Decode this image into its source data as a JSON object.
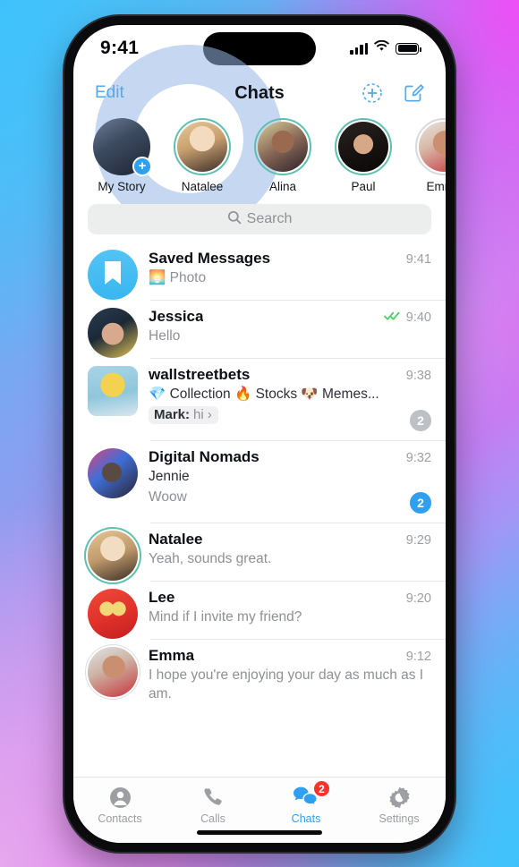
{
  "status_bar": {
    "time": "9:41",
    "signal_icon": "cellular-bars-icon",
    "wifi_icon": "wifi-icon",
    "battery_icon": "battery-icon"
  },
  "nav": {
    "edit_label": "Edit",
    "title": "Chats",
    "add_story_icon": "add-story-icon",
    "compose_icon": "compose-icon"
  },
  "stories": [
    {
      "name": "My Story",
      "ring": "none",
      "has_plus": true
    },
    {
      "name": "Natalee",
      "ring": "green",
      "has_plus": false
    },
    {
      "name": "Alina",
      "ring": "green",
      "has_plus": false
    },
    {
      "name": "Paul",
      "ring": "green",
      "has_plus": false
    },
    {
      "name": "Emma",
      "ring": "gray",
      "has_plus": false
    }
  ],
  "search": {
    "placeholder": "Search",
    "icon": "search-icon"
  },
  "chats": [
    {
      "name": "Saved Messages",
      "time": "9:41",
      "preview": "🌅 Photo",
      "avatar_kind": "saved-bookmark",
      "ring": "none",
      "badge": null,
      "badge_color": null,
      "ticks": false,
      "author": null,
      "reply": null,
      "two_line": false
    },
    {
      "name": "Jessica",
      "time": "9:40",
      "preview": "Hello",
      "avatar_kind": "photo",
      "ring": "none",
      "badge": null,
      "badge_color": null,
      "ticks": true,
      "author": null,
      "reply": null,
      "two_line": false
    },
    {
      "name": "wallstreetbets",
      "time": "9:38",
      "preview": "💎 Collection 🔥 Stocks 🐶 Memes...",
      "avatar_kind": "photo",
      "ring": "none",
      "badge": "2",
      "badge_color": "gray",
      "ticks": false,
      "author": null,
      "reply": {
        "author": "Mark:",
        "text": "hi",
        "chevron": "›"
      },
      "two_line": false
    },
    {
      "name": "Digital Nomads",
      "time": "9:32",
      "preview": "Woow",
      "avatar_kind": "photo",
      "ring": "none",
      "badge": "2",
      "badge_color": "blue",
      "ticks": false,
      "author": "Jennie",
      "reply": null,
      "two_line": false
    },
    {
      "name": "Natalee",
      "time": "9:29",
      "preview": "Yeah, sounds great.",
      "avatar_kind": "photo",
      "ring": "green",
      "badge": null,
      "badge_color": null,
      "ticks": false,
      "author": null,
      "reply": null,
      "two_line": false
    },
    {
      "name": "Lee",
      "time": "9:20",
      "preview": "Mind if I invite my friend?",
      "avatar_kind": "photo",
      "ring": "none",
      "badge": null,
      "badge_color": null,
      "ticks": false,
      "author": null,
      "reply": null,
      "two_line": false
    },
    {
      "name": "Emma",
      "time": "9:12",
      "preview": "I hope you're enjoying your day as much as I am.",
      "avatar_kind": "photo",
      "ring": "gray",
      "badge": null,
      "badge_color": null,
      "ticks": false,
      "author": null,
      "reply": null,
      "two_line": true
    }
  ],
  "tabs": [
    {
      "label": "Contacts",
      "icon": "contacts-icon",
      "active": false,
      "badge": null
    },
    {
      "label": "Calls",
      "icon": "phone-icon",
      "active": false,
      "badge": null
    },
    {
      "label": "Chats",
      "icon": "chats-bubbles-icon",
      "active": true,
      "badge": "2"
    },
    {
      "label": "Settings",
      "icon": "gear-icon",
      "active": false,
      "badge": null
    }
  ],
  "colors": {
    "accent_blue": "#2f9ff0",
    "link_blue": "#54a9e8",
    "story_ring_green": "#5fc0ae",
    "badge_red": "#f5342b",
    "muted_badge_gray": "#bdc0c5",
    "tick_green": "#4cd063"
  }
}
